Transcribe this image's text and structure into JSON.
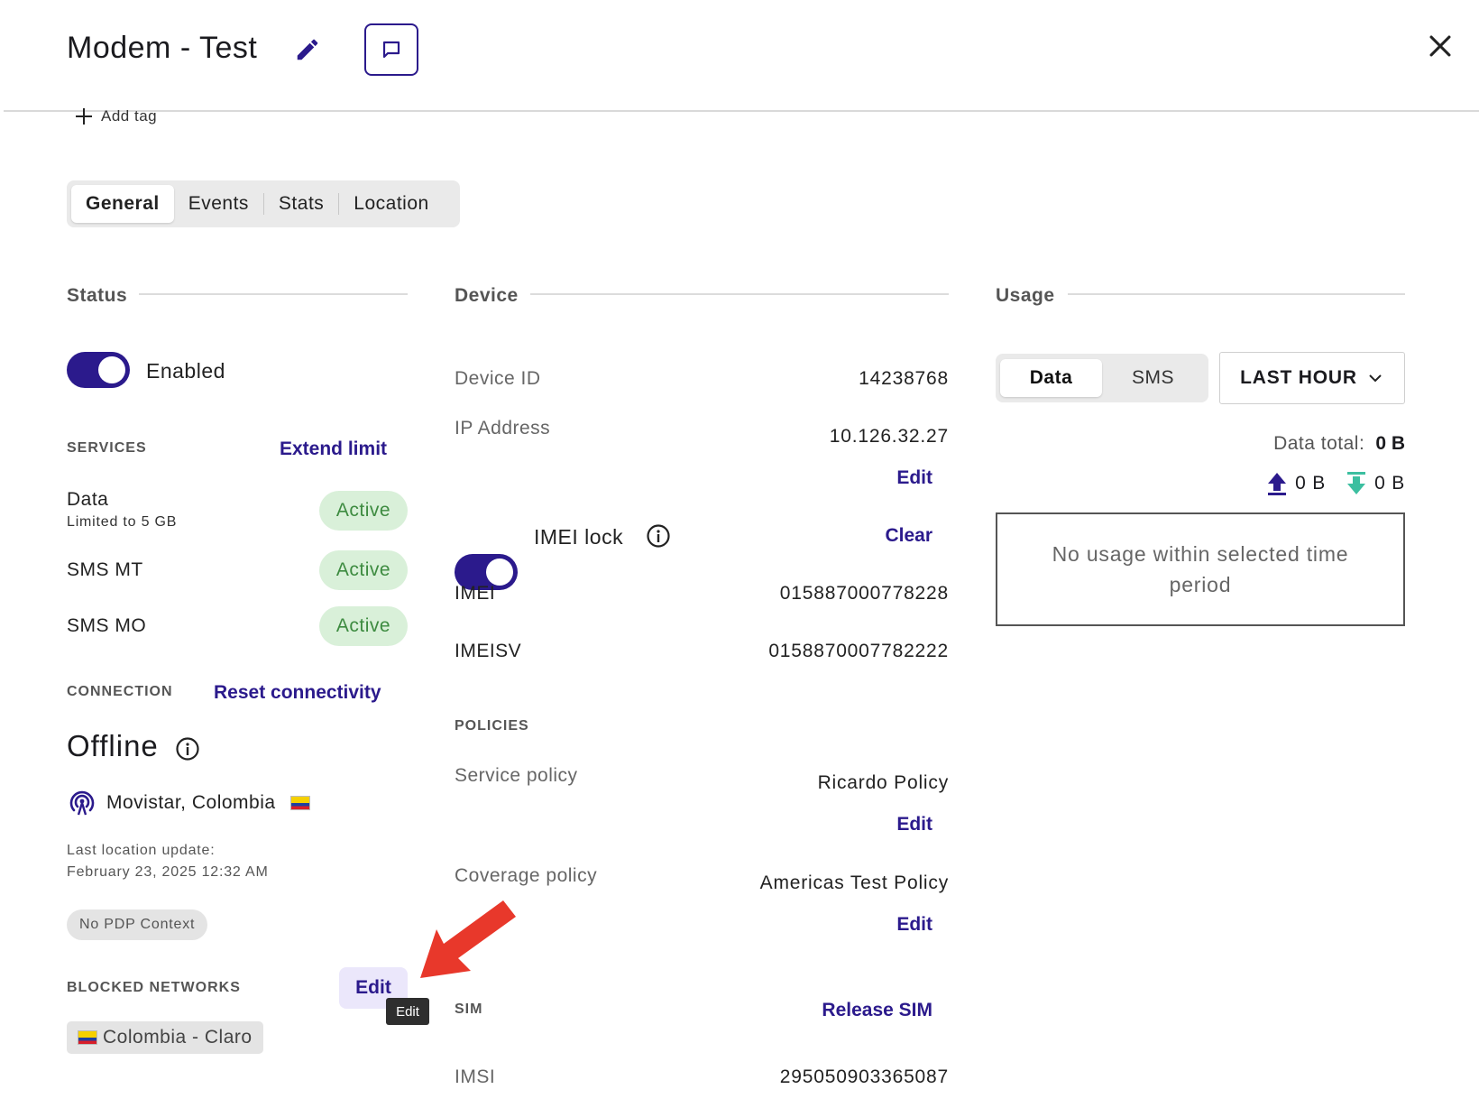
{
  "header": {
    "title": "Modem - Test",
    "add_tag": "Add tag"
  },
  "tabs": [
    {
      "label": "General",
      "active": true
    },
    {
      "label": "Events",
      "active": false
    },
    {
      "label": "Stats",
      "active": false
    },
    {
      "label": "Location",
      "active": false
    }
  ],
  "status": {
    "heading": "Status",
    "enabled_label": "Enabled",
    "enabled": true,
    "services_heading": "SERVICES",
    "extend_limit": "Extend limit",
    "services": [
      {
        "name": "Data",
        "sub": "Limited to 5 GB",
        "state": "Active"
      },
      {
        "name": "SMS MT",
        "sub": "",
        "state": "Active"
      },
      {
        "name": "SMS MO",
        "sub": "",
        "state": "Active"
      }
    ],
    "connection_heading": "CONNECTION",
    "reset_connectivity": "Reset connectivity",
    "connection_state": "Offline",
    "operator": "Movistar, Colombia",
    "last_update_label": "Last location update:",
    "last_update_value": "February 23, 2025 12:32 AM",
    "pdp_badge": "No PDP Context",
    "blocked_heading": "BLOCKED NETWORKS",
    "blocked_edit": "Edit",
    "tooltip": "Edit",
    "blocked_networks": [
      "Colombia - Claro"
    ]
  },
  "device": {
    "heading": "Device",
    "device_id_label": "Device ID",
    "device_id": "14238768",
    "ip_label": "IP Address",
    "ip": "10.126.32.27",
    "ip_edit": "Edit",
    "imei_lock_label": "IMEI lock",
    "imei_lock_on": true,
    "imei_clear": "Clear",
    "imei_label": "IMEI",
    "imei": "015887000778228",
    "imeisv_label": "IMEISV",
    "imeisv": "0158870007782222",
    "policies_heading": "POLICIES",
    "service_policy_label": "Service policy",
    "service_policy": "Ricardo Policy",
    "service_policy_edit": "Edit",
    "coverage_policy_label": "Coverage policy",
    "coverage_policy": "Americas Test Policy",
    "coverage_policy_edit": "Edit",
    "sim_heading": "SIM",
    "release_sim": "Release SIM",
    "imsi_label": "IMSI",
    "imsi": "295050903365087"
  },
  "usage": {
    "heading": "Usage",
    "seg_data": "Data",
    "seg_sms": "SMS",
    "range": "LAST HOUR",
    "data_total_label": "Data total:",
    "data_total": "0 B",
    "upload": "0 B",
    "download": "0 B",
    "empty_message": "No usage within selected time period"
  },
  "colors": {
    "accent": "#2b1a8c",
    "active_green_bg": "#d9f0d9",
    "active_green_text": "#3d8b40",
    "annotation_arrow": "#e8382b",
    "download_icon": "#3cbfa0"
  }
}
